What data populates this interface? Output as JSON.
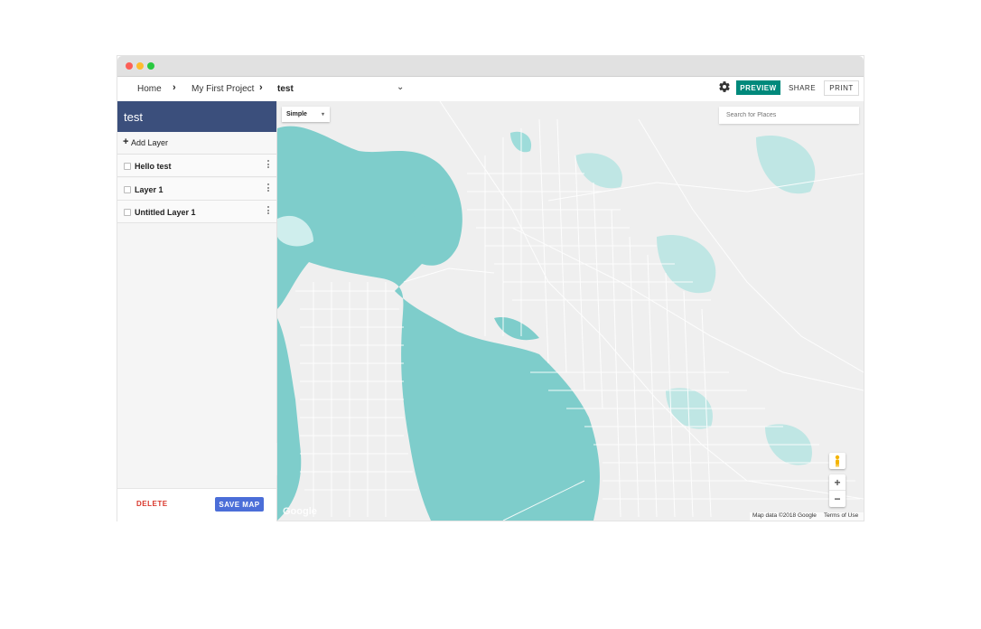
{
  "breadcrumb": {
    "home": "Home",
    "sep1": "›",
    "project": "My First Project",
    "sep2": "›",
    "map": "test",
    "map_caret": "⌄"
  },
  "toolbar": {
    "gear_icon": "gear-icon",
    "preview_label": "PREVIEW",
    "share_label": "SHARE",
    "print_label": "PRINT",
    "preview_color": "#00897b"
  },
  "sidebar": {
    "title": "test",
    "header_color": "#3b4f7c",
    "add_layer_plus": "+",
    "add_layer_label": "Add Layer",
    "layers": [
      {
        "name": "Hello test"
      },
      {
        "name": "Layer 1"
      },
      {
        "name": "Untitled Layer 1"
      }
    ],
    "delete_label": "DELETE",
    "save_label": "SAVE MAP",
    "collapse_icon": "◂"
  },
  "map": {
    "type_value": "Simple",
    "type_caret": "▾",
    "search_placeholder": "Search for Places",
    "zoom_in": "+",
    "zoom_out": "−",
    "attribution_data": "Map data ©2018 Google",
    "attribution_terms": "Terms of Use",
    "logo_text": "Google",
    "water_color": "#7ecdcb",
    "land_color": "#efefef"
  }
}
